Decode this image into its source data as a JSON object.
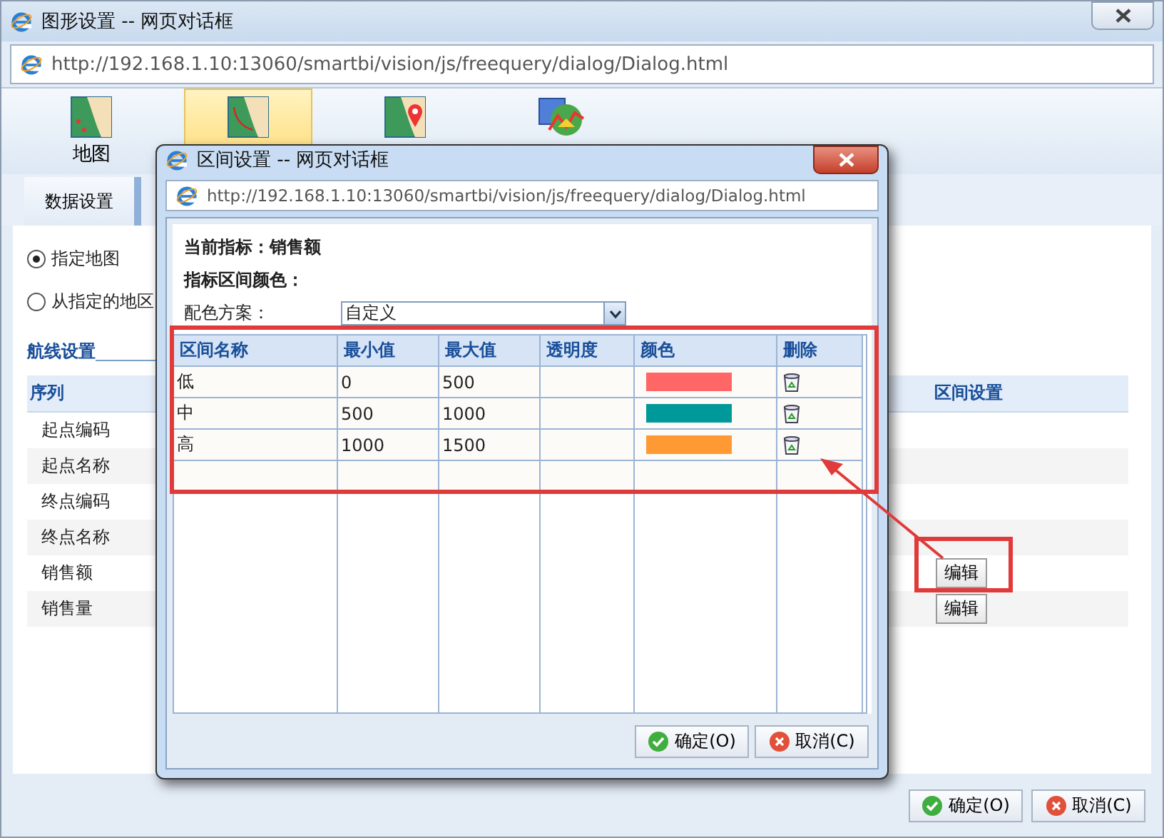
{
  "window": {
    "title": "图形设置 -- 网页对话框",
    "url": "http://192.168.1.10:13060/smartbi/vision/js/freequery/dialog/Dialog.html"
  },
  "toolbar": [
    {
      "kind": "map",
      "label": "地图",
      "selected": false
    },
    {
      "kind": "route",
      "selected": true
    },
    {
      "kind": "pin",
      "selected": false
    },
    {
      "kind": "chart",
      "selected": false
    }
  ],
  "tabs": [
    {
      "label": "数据设置",
      "selected": true
    }
  ],
  "radios": [
    {
      "label": "指定地图",
      "selected": true
    },
    {
      "label": "从指定的地区",
      "selected": false
    }
  ],
  "section_title": "航线设置",
  "series_table": {
    "columns": [
      "序列",
      "区间设置"
    ],
    "rows": [
      {
        "name": "起点编码"
      },
      {
        "name": "起点名称"
      },
      {
        "name": "终点编码"
      },
      {
        "name": "终点名称"
      },
      {
        "name": "销售额",
        "action": "编辑",
        "highlighted": true
      },
      {
        "name": "销售量",
        "action": "编辑",
        "highlighted": false
      }
    ]
  },
  "buttons": [
    {
      "kind": "ok",
      "label": "确定(O)"
    },
    {
      "kind": "cancel",
      "label": "取消(C)"
    }
  ],
  "dialog": {
    "title": "区间设置 -- 网页对话框",
    "url": "http://192.168.1.10:13060/smartbi/vision/js/freequery/dialog/Dialog.html",
    "current_indicator": "当前指标：销售额",
    "range_color_label": "指标区间颜色：",
    "scheme_label": "配色方案：",
    "scheme_value": "自定义",
    "table": {
      "columns": [
        "区间名称",
        "最小值",
        "最大值",
        "透明度",
        "颜色",
        "删除"
      ],
      "rows": [
        {
          "name": "低",
          "min": "0",
          "max": "500",
          "color": "#ff6666"
        },
        {
          "name": "中",
          "min": "500",
          "max": "1000",
          "color": "#009999"
        },
        {
          "name": "高",
          "min": "1000",
          "max": "1500",
          "color": "#ff9933"
        }
      ]
    },
    "buttons": [
      {
        "kind": "ok",
        "label": "确定(O)"
      },
      {
        "kind": "cancel",
        "label": "取消(C)"
      }
    ]
  }
}
